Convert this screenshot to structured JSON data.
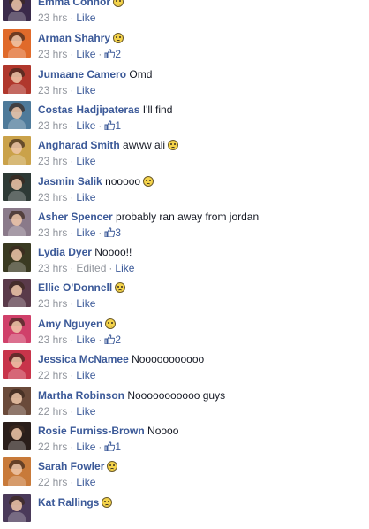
{
  "comments": [
    {
      "author": "Emma Connor",
      "text": "",
      "emoji": "confused-emoji",
      "time": "23 hrs",
      "edited": "",
      "like_label": "Like",
      "likes": "",
      "avatar_color": "#3a2a4a"
    },
    {
      "author": "Arman Shahry",
      "text": "",
      "emoji": "crying-laughing-emoji",
      "time": "23 hrs",
      "edited": "",
      "like_label": "Like",
      "likes": "2",
      "avatar_color": "#e06a2a"
    },
    {
      "author": "Jumaane Camero",
      "text": "Omd",
      "emoji": "",
      "time": "23 hrs",
      "edited": "",
      "like_label": "Like",
      "likes": "",
      "avatar_color": "#b0372c"
    },
    {
      "author": "Costas Hadjipateras",
      "text": "I'll find",
      "emoji": "",
      "time": "23 hrs",
      "edited": "",
      "like_label": "Like",
      "likes": "1",
      "avatar_color": "#4e7a9a"
    },
    {
      "author": "Angharad Smith",
      "text": "awww ali",
      "emoji": "sad-emoji",
      "time": "23 hrs",
      "edited": "",
      "like_label": "Like",
      "likes": "",
      "avatar_color": "#caa24a"
    },
    {
      "author": "Jasmin Salik",
      "text": "nooooo",
      "emoji": "sad-emoji",
      "time": "23 hrs",
      "edited": "",
      "like_label": "Like",
      "likes": "",
      "avatar_color": "#2e3a36"
    },
    {
      "author": "Asher Spencer",
      "text": "probably ran away from jordan",
      "emoji": "",
      "time": "23 hrs",
      "edited": "",
      "like_label": "Like",
      "likes": "3",
      "avatar_color": "#8a7a8a"
    },
    {
      "author": "Lydia Dyer",
      "text": "Noooo!!",
      "emoji": "",
      "time": "23 hrs",
      "edited": "Edited",
      "like_label": "Like",
      "likes": "",
      "avatar_color": "#3a3a22"
    },
    {
      "author": "Ellie O'Donnell",
      "text": "",
      "emoji": "sad-emoji",
      "time": "23 hrs",
      "edited": "",
      "like_label": "Like",
      "likes": "",
      "avatar_color": "#5a3a4a"
    },
    {
      "author": "Amy Nguyen",
      "text": "",
      "emoji": "pensive-emoji",
      "time": "23 hrs",
      "edited": "",
      "like_label": "Like",
      "likes": "2",
      "avatar_color": "#d0406a"
    },
    {
      "author": "Jessica McNamee",
      "text": "Nooooooooooo",
      "emoji": "",
      "time": "22 hrs",
      "edited": "",
      "like_label": "Like",
      "likes": "",
      "avatar_color": "#c8344a"
    },
    {
      "author": "Martha Robinson",
      "text": "Nooooooooooo guys",
      "emoji": "",
      "time": "22 hrs",
      "edited": "",
      "like_label": "Like",
      "likes": "",
      "avatar_color": "#6a4a3a"
    },
    {
      "author": "Rosie Furniss-Brown",
      "text": "Noooo",
      "emoji": "",
      "time": "22 hrs",
      "edited": "",
      "like_label": "Like",
      "likes": "1",
      "avatar_color": "#2a1e1a"
    },
    {
      "author": "Sarah Fowler",
      "text": "",
      "emoji": "confused-emoji",
      "time": "22 hrs",
      "edited": "",
      "like_label": "Like",
      "likes": "",
      "avatar_color": "#c87a3a"
    },
    {
      "author": "Kat Rallings",
      "text": "",
      "emoji": "sad-emoji",
      "time": "",
      "edited": "",
      "like_label": "",
      "likes": "",
      "avatar_color": "#4a3a5a"
    }
  ],
  "colors": {
    "link": "#3b5998",
    "meta": "#90949c",
    "text": "#141823"
  }
}
